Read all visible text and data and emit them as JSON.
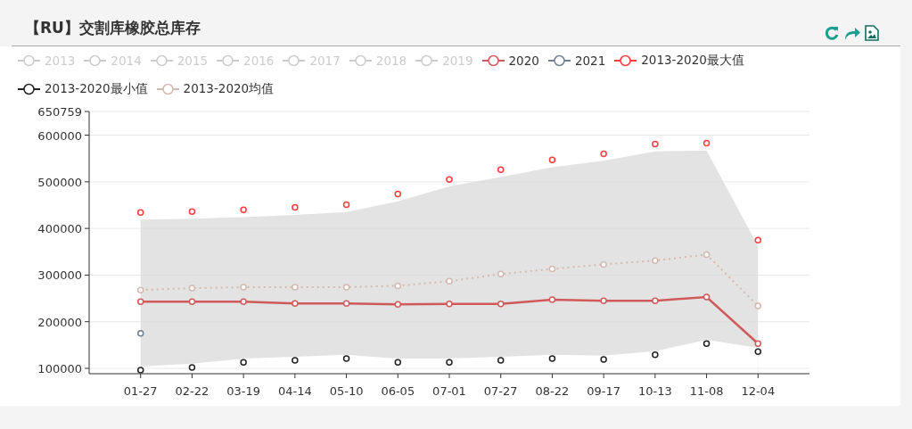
{
  "title": "【RU】交割库橡胶总库存",
  "legend": [
    {
      "label": "2013",
      "color": "#cccccc",
      "selected": false
    },
    {
      "label": "2014",
      "color": "#cccccc",
      "selected": false
    },
    {
      "label": "2015",
      "color": "#cccccc",
      "selected": false
    },
    {
      "label": "2016",
      "color": "#cccccc",
      "selected": false
    },
    {
      "label": "2017",
      "color": "#cccccc",
      "selected": false
    },
    {
      "label": "2018",
      "color": "#cccccc",
      "selected": false
    },
    {
      "label": "2019",
      "color": "#cccccc",
      "selected": false
    }
  ],
  "chart_data": {
    "type": "line",
    "grid": true,
    "categories": [
      "01-27",
      "02-22",
      "03-19",
      "04-14",
      "05-10",
      "06-05",
      "07-01",
      "07-27",
      "08-22",
      "09-17",
      "10-13",
      "11-08",
      "12-04"
    ],
    "ylim": [
      88500,
      650759
    ],
    "yticks": [
      100000,
      200000,
      300000,
      400000,
      500000,
      600000,
      650759
    ],
    "series": [
      {
        "type": "area",
        "color": "#e3e3e3",
        "values": [
          419000,
          421000,
          424000,
          429000,
          435000,
          458000,
          490000,
          510000,
          531000,
          545000,
          565000,
          567000,
          362000
        ]
      },
      {
        "type": "area",
        "color": "#ffffff",
        "values": [
          104000,
          110000,
          121000,
          125000,
          129000,
          121000,
          121000,
          125000,
          129000,
          127000,
          137000,
          161000,
          144000
        ]
      },
      {
        "name": "2020",
        "color": "#d05a5a",
        "type": "line",
        "line_style": "solid",
        "marker": "circle",
        "values": [
          243000,
          243000,
          243000,
          239000,
          239000,
          237000,
          238000,
          238000,
          247000,
          245000,
          245000,
          253000,
          153000
        ]
      },
      {
        "name": "2021",
        "color": "#6e7f8f",
        "type": "line",
        "line_style": "solid",
        "marker": "circle",
        "values": [
          175000,
          null,
          null,
          null,
          null,
          null,
          null,
          null,
          null,
          null,
          null,
          null,
          null
        ]
      },
      {
        "name": "2013-2020最大值",
        "color": "#ff3b3b",
        "type": "scatter",
        "marker": "circle",
        "values": [
          434000,
          436000,
          440000,
          445000,
          451000,
          474000,
          505000,
          526000,
          547000,
          560000,
          581000,
          583000,
          375000
        ]
      },
      {
        "name": "2013-2020最小值",
        "color": "#222222",
        "type": "scatter",
        "marker": "circle",
        "values": [
          96000,
          102000,
          113000,
          117000,
          121000,
          113000,
          113000,
          117000,
          121000,
          119000,
          129000,
          153000,
          136000
        ]
      },
      {
        "name": "2013-2020均值",
        "color": "#d4b9ae",
        "type": "line",
        "line_style": "dotted",
        "marker": "circle",
        "values": [
          268000,
          272000,
          274000,
          274000,
          274000,
          277000,
          287000,
          302000,
          313000,
          323000,
          331000,
          344000,
          234000
        ]
      }
    ]
  }
}
